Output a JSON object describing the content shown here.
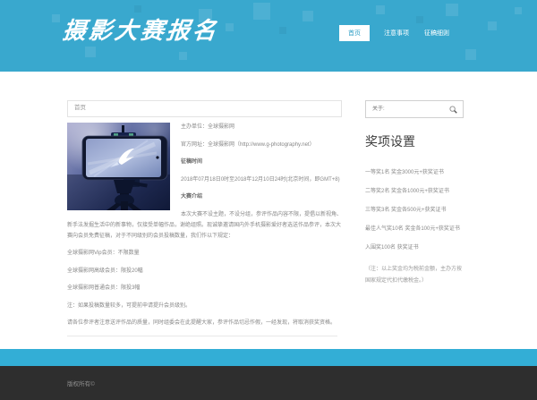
{
  "header": {
    "title": "摄影大赛报名",
    "nav": [
      {
        "label": "首页",
        "active": true
      },
      {
        "label": "注意事项",
        "active": false
      },
      {
        "label": "征稿细则",
        "active": false
      }
    ]
  },
  "breadcrumb": "首页",
  "article": {
    "host_line": "主办单位：全球摄影网",
    "site_line": "官方网址：全球摄影网（http://www.g-photography.net）",
    "period_heading": "征稿时间",
    "period_text": "2018年07月18日0时至2018年12月10日24时(北京时间，即GMT+8)",
    "intro_heading": "大赛介绍",
    "intro_text": "本次大赛不设主题，不设分组，参评作品内容不限，提倡以新视角、新手法发掘生活中的新事物，仅接受单幅作品，谢绝组照。现诚挚邀请国内外手机摄影爱好者选送作品参评，本次大赛向会员免费征稿，对于不同级别的会员投稿数量，我们作以下规定：",
    "quotas": [
      "全球摄影网Vip会员：不限数量",
      "全球摄影网高级会员：限投20幅",
      "全球摄影网普通会员：限投3幅"
    ],
    "note_line": "注：如果投稿数量较多，可提前申请提升会员级别。",
    "warning_line": "请各位参评者注意送评作品的质量，同时组委会在此提醒大家，参评作品切忌作假，一经发现，将取消获奖资格。"
  },
  "sidebar": {
    "search_placeholder": "关于:",
    "search_icon": "magnifier-icon",
    "awards_title": "奖项设置",
    "awards": [
      "一等奖1名 奖金3000元+获奖证书",
      "二等奖2名 奖金各1000元+获奖证书",
      "三等奖3名 奖金各500元+获奖证书",
      "最佳人气奖10名 奖金各100元+获奖证书",
      "入围奖100名 获奖证书"
    ],
    "awards_note": "（注：以上奖金均为税前金额，主办方按国家规定代扣代缴税金。）"
  },
  "footer": {
    "copyright": "版权所有©"
  },
  "colors": {
    "header_bg": "#39a8ce",
    "strip_bg": "#33aed6",
    "footer_bg": "#2e2e2e",
    "nav_active_text": "#2f9fc6",
    "body_text": "#878787"
  }
}
